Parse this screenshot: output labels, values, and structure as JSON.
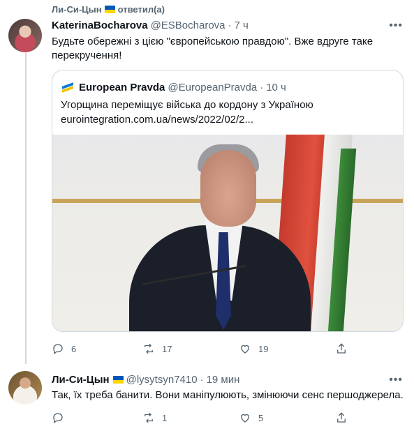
{
  "social_context": {
    "user": "Ли-Си-Цын",
    "action": "ответил(а)"
  },
  "tweet1": {
    "name": "KaterinaBocharova",
    "handle": "@ESBocharova",
    "time": "7 ч",
    "text_lines": [
      "Будьте обережні з цією \"європейською правдою\". Вже вдруге таке",
      "перекручення!"
    ],
    "replies": "6",
    "retweets": "17",
    "likes": "19"
  },
  "quote": {
    "name": "European Pravda",
    "handle": "@EuropeanPravda",
    "time": "10 ч",
    "text": "Угорщина переміщує війська до кордону з Україною",
    "link": "eurointegration.com.ua/news/2022/02/2..."
  },
  "tweet2": {
    "name": "Ли-Си-Цын",
    "handle": "@lysytsyn7410",
    "time": "19 мин",
    "text": "Так, їх треба банити. Вони маніпулюють, змінюючи сенс першоджерела.",
    "replies": "",
    "retweets": "1",
    "likes": "5"
  },
  "ui": {
    "more": "•••",
    "dot": "·"
  },
  "colors": {
    "text": "#0f1419",
    "secondary": "#536471",
    "border": "#cfd9de",
    "flag_blue": "#0057b7",
    "flag_yellow": "#ffd700"
  }
}
